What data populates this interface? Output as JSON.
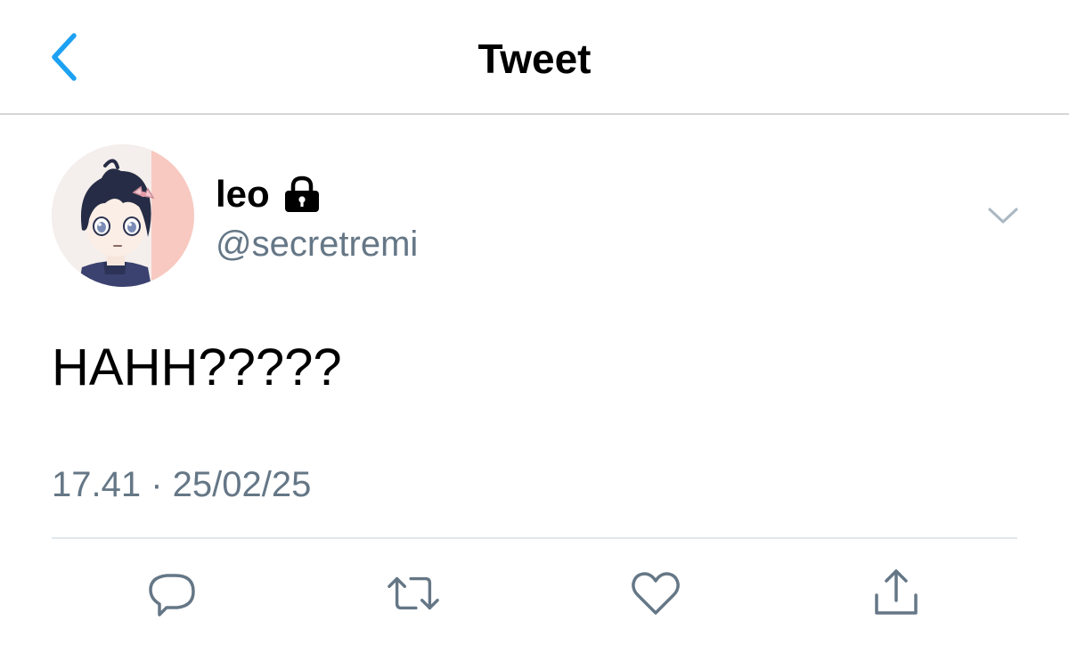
{
  "header": {
    "title": "Tweet",
    "back_icon": "chevron-left-icon"
  },
  "author": {
    "display_name": "leo",
    "protected_icon": "lock-icon",
    "username": "@secretremi",
    "avatar_description": "anime boy avatar"
  },
  "tweet": {
    "text": "HAHH?????",
    "timestamp": "17.41 · 25/02/25"
  },
  "actions": {
    "reply_icon": "reply-icon",
    "retweet_icon": "retweet-icon",
    "like_icon": "heart-icon",
    "share_icon": "share-icon"
  },
  "colors": {
    "accent": "#1da1f2",
    "secondary_text": "#657786",
    "divider": "#e1e8ed"
  }
}
